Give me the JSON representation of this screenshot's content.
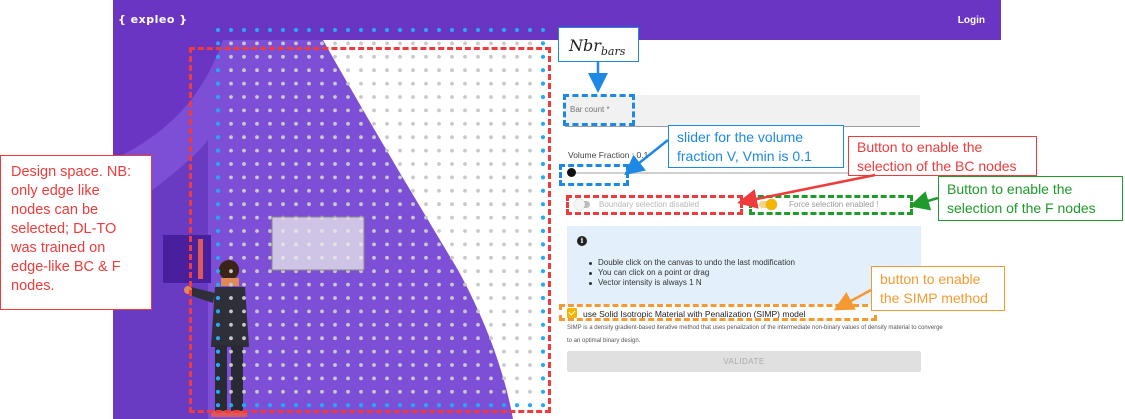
{
  "app": {
    "brand": "{ expleo }",
    "login_label": "Login"
  },
  "form": {
    "bar_count_label": "Bar count *",
    "volume_fraction_label": "Volume Fraction : 0.1",
    "volume_fraction_value": 0.1,
    "boundary_toggle_label": "Boundary selection disabled",
    "boundary_toggle_on": false,
    "force_toggle_label": "Force selection enabled !",
    "force_toggle_on": true,
    "info_icon": "info-icon",
    "info_items": [
      "Double click on the canvas to undo the last modification",
      "You can click on a point or drag",
      "Vector intensity is always 1 N"
    ],
    "simp_checked": true,
    "simp_label": "use Solid Isotropic Material with Penalization (SIMP) model",
    "simp_description": "SIMP is a density gradient-based iterative method that uses penalization of the intermediate non-binary values of density material to converge to an optimal binary design.",
    "validate_label": "VALIDATE"
  },
  "annotations": {
    "design_space": "Design space. NB:\nonly edge like\nnodes can be\nselected; DL-TO\nwas trained on\nedge-like BC & F\nnodes.",
    "nbr_bars_main": "Nbr",
    "nbr_bars_sub": "bars",
    "slider_note": "slider for the volume\nfraction V, Vmin is 0.1",
    "bc_button_note": "Button to enable the\nselection of the BC nodes",
    "f_button_note": "Button to enable the\nselection of the F nodes",
    "simp_button_note": "button to enable\nthe SIMP method"
  },
  "colors": {
    "topbar": "#6a35c2",
    "wave": "#7c4fd6",
    "edge_node": "#29a8f2",
    "interior_node": "#c9c9c9",
    "annotation_red": "#ef3b3b",
    "annotation_blue": "#1e88e5",
    "annotation_green": "#1e9b2a",
    "annotation_orange": "#f59a33",
    "toggle_accent": "#f4b400"
  }
}
